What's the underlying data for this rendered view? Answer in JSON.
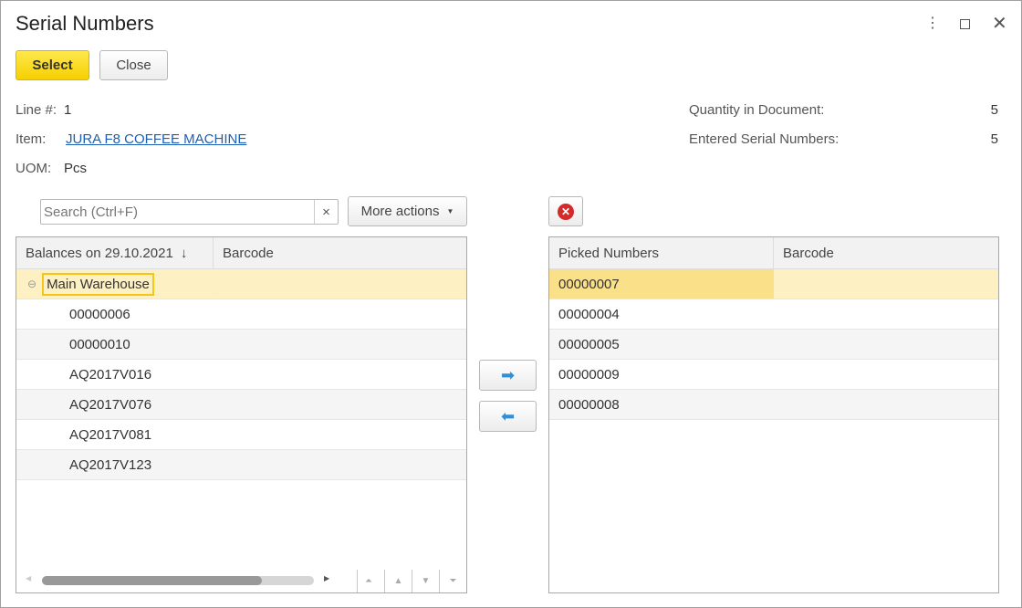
{
  "window": {
    "title": "Serial Numbers"
  },
  "toolbar": {
    "select_label": "Select",
    "close_label": "Close"
  },
  "info": {
    "line_label": "Line #:",
    "line_value": "1",
    "item_label": "Item:",
    "item_value": "JURA F8 COFFEE MACHINE",
    "uom_label": "UOM:",
    "uom_value": "Pcs",
    "qty_doc_label": "Quantity in Document:",
    "qty_doc_value": "5",
    "entered_label": "Entered Serial Numbers:",
    "entered_value": "5"
  },
  "left": {
    "search_placeholder": "Search (Ctrl+F)",
    "more_actions": "More actions",
    "col1": "Balances on 29.10.2021",
    "col2": "Barcode",
    "group": "Main Warehouse",
    "items": [
      "00000006",
      "00000010",
      "AQ2017V016",
      "AQ2017V076",
      "AQ2017V081",
      "AQ2017V123"
    ],
    "scroll_fraction": 0.81
  },
  "right": {
    "col1": "Picked Numbers",
    "col2": "Barcode",
    "items": [
      "00000007",
      "00000004",
      "00000005",
      "00000009",
      "00000008"
    ]
  }
}
